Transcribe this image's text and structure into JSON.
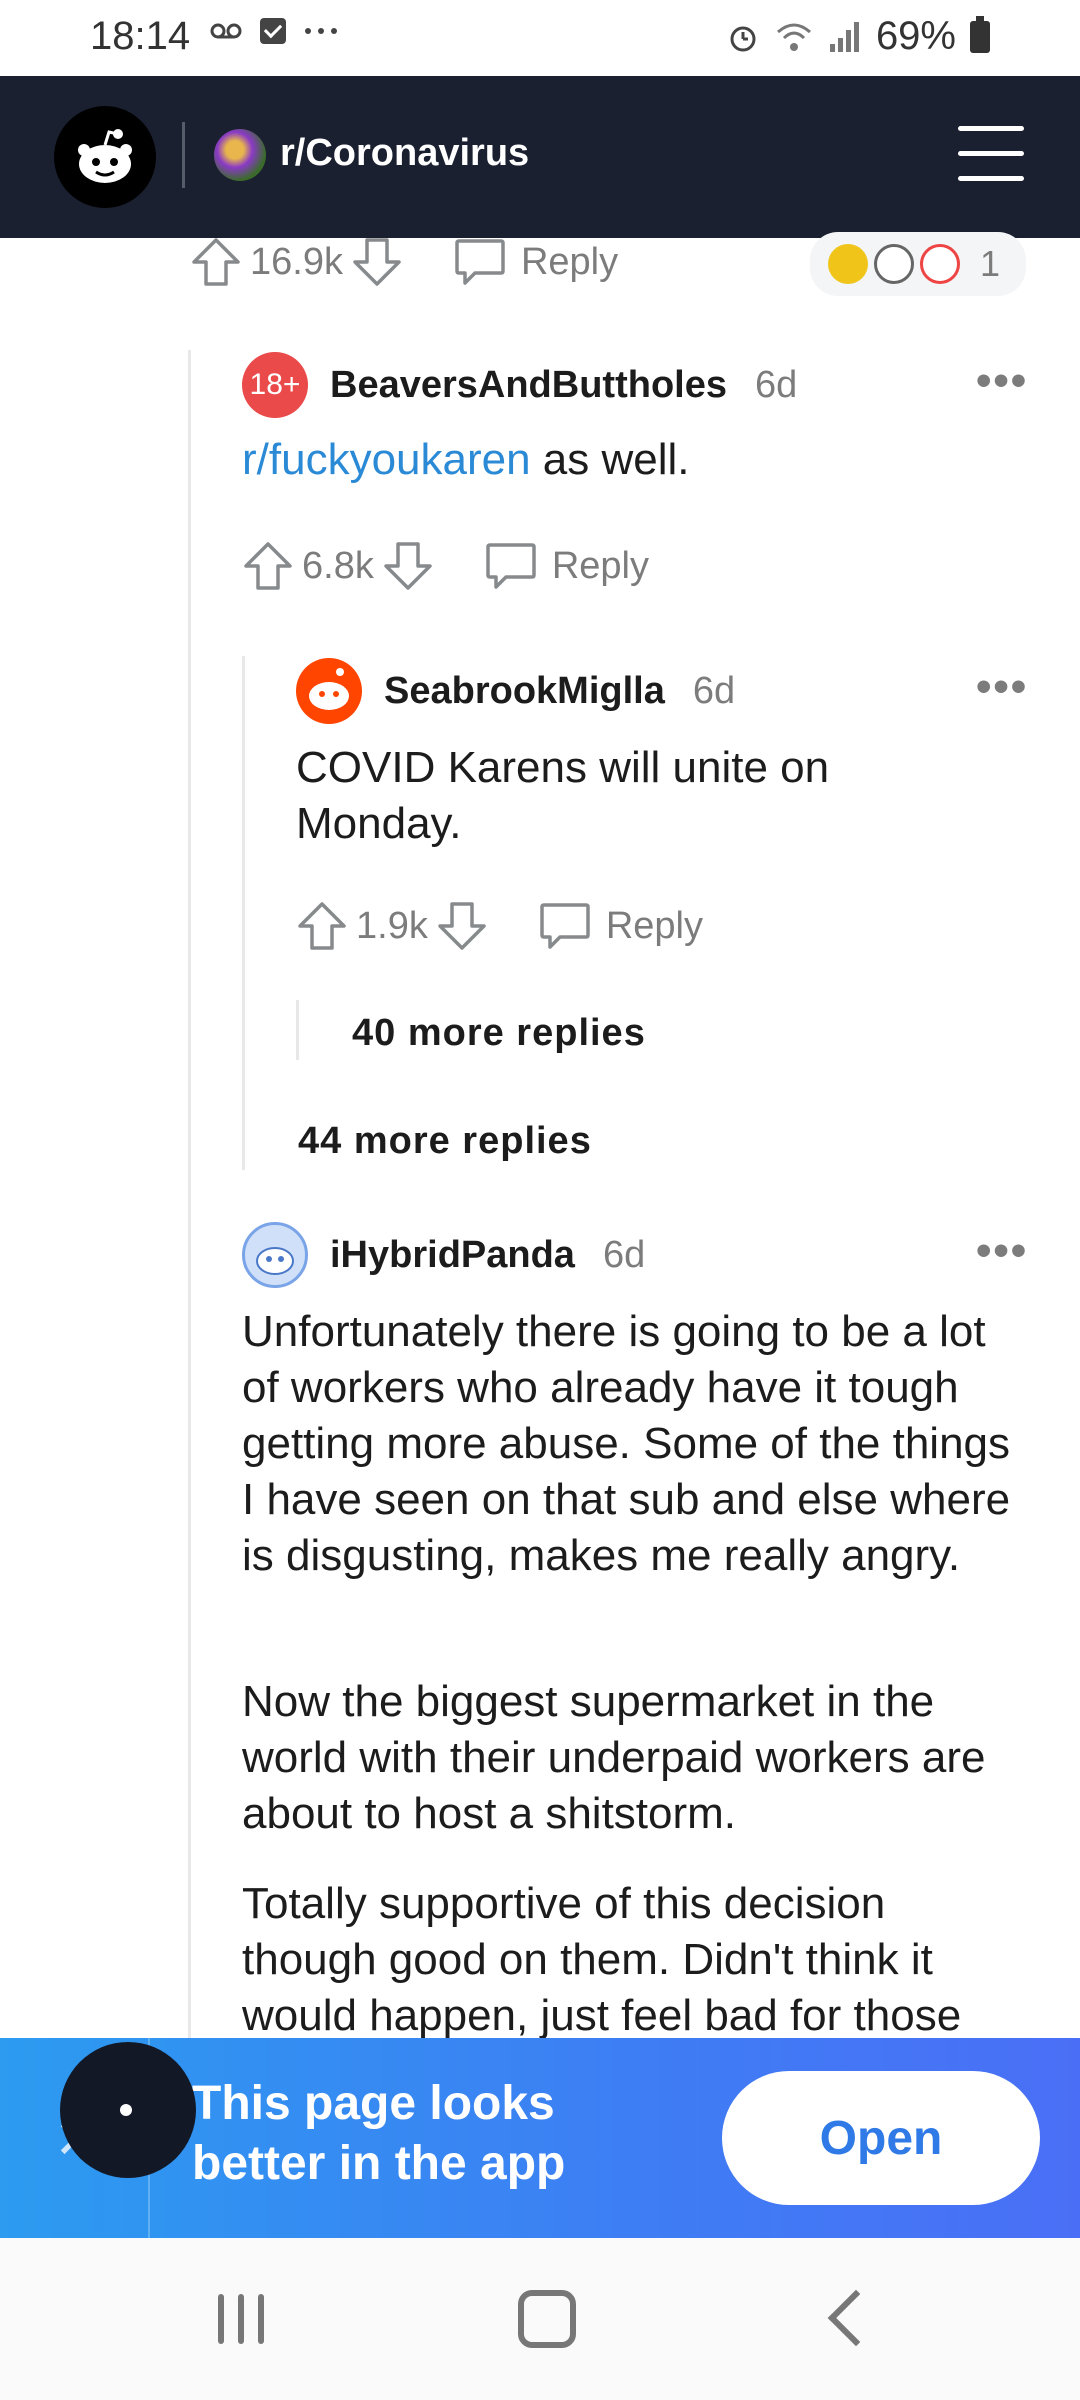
{
  "status_bar": {
    "time": "18:14",
    "battery": "69%"
  },
  "header": {
    "subreddit": "r/Coronavirus"
  },
  "top_comment": {
    "votes": "16.9k",
    "reply_label": "Reply",
    "award_count": "1"
  },
  "comments": [
    {
      "username": "BeaversAndButtholes",
      "age": "6d",
      "link_text": "r/fuckyoukaren",
      "body_rest": " as well.",
      "votes": "6.8k",
      "reply_label": "Reply"
    },
    {
      "username": "SeabrookMiglla",
      "age": "6d",
      "body": "COVID Karens will unite on Monday.",
      "votes": "1.9k",
      "reply_label": "Reply",
      "more_replies": "40 more replies"
    },
    {
      "username": "iHybridPanda",
      "age": "6d",
      "paragraphs": [
        "Unfortunately there is going to be a lot of workers who already have it tough getting more abuse. Some of the things I have seen on that sub and else where is disgusting, makes me really angry.",
        "Now the biggest supermarket in the world with their underpaid workers are about to host a shitstorm.",
        "Totally supportive of this decision though good on them. Didn't think it would happen, just feel bad for those"
      ]
    }
  ],
  "thread_more_replies": "44 more replies",
  "banner": {
    "text": "This page looks better in the app",
    "open_label": "Open"
  },
  "colors": {
    "header_bg": "#1a2030",
    "link": "#2b8ad6",
    "banner_start": "#2c9bf0",
    "banner_end": "#4a6ff6"
  }
}
